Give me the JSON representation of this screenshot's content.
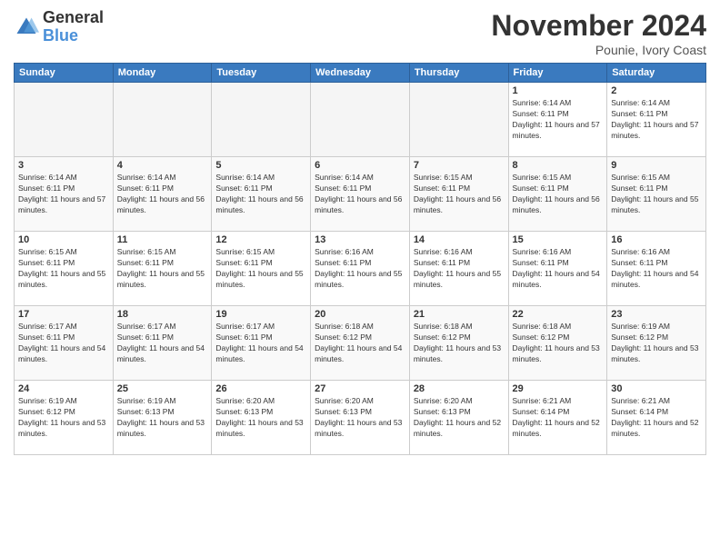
{
  "logo": {
    "general": "General",
    "blue": "Blue"
  },
  "title": "November 2024",
  "location": "Pounie, Ivory Coast",
  "days_of_week": [
    "Sunday",
    "Monday",
    "Tuesday",
    "Wednesday",
    "Thursday",
    "Friday",
    "Saturday"
  ],
  "weeks": [
    [
      {
        "day": "",
        "empty": true
      },
      {
        "day": "",
        "empty": true
      },
      {
        "day": "",
        "empty": true
      },
      {
        "day": "",
        "empty": true
      },
      {
        "day": "",
        "empty": true
      },
      {
        "day": "1",
        "sunrise": "Sunrise: 6:14 AM",
        "sunset": "Sunset: 6:11 PM",
        "daylight": "Daylight: 11 hours and 57 minutes."
      },
      {
        "day": "2",
        "sunrise": "Sunrise: 6:14 AM",
        "sunset": "Sunset: 6:11 PM",
        "daylight": "Daylight: 11 hours and 57 minutes."
      }
    ],
    [
      {
        "day": "3",
        "sunrise": "Sunrise: 6:14 AM",
        "sunset": "Sunset: 6:11 PM",
        "daylight": "Daylight: 11 hours and 57 minutes."
      },
      {
        "day": "4",
        "sunrise": "Sunrise: 6:14 AM",
        "sunset": "Sunset: 6:11 PM",
        "daylight": "Daylight: 11 hours and 56 minutes."
      },
      {
        "day": "5",
        "sunrise": "Sunrise: 6:14 AM",
        "sunset": "Sunset: 6:11 PM",
        "daylight": "Daylight: 11 hours and 56 minutes."
      },
      {
        "day": "6",
        "sunrise": "Sunrise: 6:14 AM",
        "sunset": "Sunset: 6:11 PM",
        "daylight": "Daylight: 11 hours and 56 minutes."
      },
      {
        "day": "7",
        "sunrise": "Sunrise: 6:15 AM",
        "sunset": "Sunset: 6:11 PM",
        "daylight": "Daylight: 11 hours and 56 minutes."
      },
      {
        "day": "8",
        "sunrise": "Sunrise: 6:15 AM",
        "sunset": "Sunset: 6:11 PM",
        "daylight": "Daylight: 11 hours and 56 minutes."
      },
      {
        "day": "9",
        "sunrise": "Sunrise: 6:15 AM",
        "sunset": "Sunset: 6:11 PM",
        "daylight": "Daylight: 11 hours and 55 minutes."
      }
    ],
    [
      {
        "day": "10",
        "sunrise": "Sunrise: 6:15 AM",
        "sunset": "Sunset: 6:11 PM",
        "daylight": "Daylight: 11 hours and 55 minutes."
      },
      {
        "day": "11",
        "sunrise": "Sunrise: 6:15 AM",
        "sunset": "Sunset: 6:11 PM",
        "daylight": "Daylight: 11 hours and 55 minutes."
      },
      {
        "day": "12",
        "sunrise": "Sunrise: 6:15 AM",
        "sunset": "Sunset: 6:11 PM",
        "daylight": "Daylight: 11 hours and 55 minutes."
      },
      {
        "day": "13",
        "sunrise": "Sunrise: 6:16 AM",
        "sunset": "Sunset: 6:11 PM",
        "daylight": "Daylight: 11 hours and 55 minutes."
      },
      {
        "day": "14",
        "sunrise": "Sunrise: 6:16 AM",
        "sunset": "Sunset: 6:11 PM",
        "daylight": "Daylight: 11 hours and 55 minutes."
      },
      {
        "day": "15",
        "sunrise": "Sunrise: 6:16 AM",
        "sunset": "Sunset: 6:11 PM",
        "daylight": "Daylight: 11 hours and 54 minutes."
      },
      {
        "day": "16",
        "sunrise": "Sunrise: 6:16 AM",
        "sunset": "Sunset: 6:11 PM",
        "daylight": "Daylight: 11 hours and 54 minutes."
      }
    ],
    [
      {
        "day": "17",
        "sunrise": "Sunrise: 6:17 AM",
        "sunset": "Sunset: 6:11 PM",
        "daylight": "Daylight: 11 hours and 54 minutes."
      },
      {
        "day": "18",
        "sunrise": "Sunrise: 6:17 AM",
        "sunset": "Sunset: 6:11 PM",
        "daylight": "Daylight: 11 hours and 54 minutes."
      },
      {
        "day": "19",
        "sunrise": "Sunrise: 6:17 AM",
        "sunset": "Sunset: 6:11 PM",
        "daylight": "Daylight: 11 hours and 54 minutes."
      },
      {
        "day": "20",
        "sunrise": "Sunrise: 6:18 AM",
        "sunset": "Sunset: 6:12 PM",
        "daylight": "Daylight: 11 hours and 54 minutes."
      },
      {
        "day": "21",
        "sunrise": "Sunrise: 6:18 AM",
        "sunset": "Sunset: 6:12 PM",
        "daylight": "Daylight: 11 hours and 53 minutes."
      },
      {
        "day": "22",
        "sunrise": "Sunrise: 6:18 AM",
        "sunset": "Sunset: 6:12 PM",
        "daylight": "Daylight: 11 hours and 53 minutes."
      },
      {
        "day": "23",
        "sunrise": "Sunrise: 6:19 AM",
        "sunset": "Sunset: 6:12 PM",
        "daylight": "Daylight: 11 hours and 53 minutes."
      }
    ],
    [
      {
        "day": "24",
        "sunrise": "Sunrise: 6:19 AM",
        "sunset": "Sunset: 6:12 PM",
        "daylight": "Daylight: 11 hours and 53 minutes."
      },
      {
        "day": "25",
        "sunrise": "Sunrise: 6:19 AM",
        "sunset": "Sunset: 6:13 PM",
        "daylight": "Daylight: 11 hours and 53 minutes."
      },
      {
        "day": "26",
        "sunrise": "Sunrise: 6:20 AM",
        "sunset": "Sunset: 6:13 PM",
        "daylight": "Daylight: 11 hours and 53 minutes."
      },
      {
        "day": "27",
        "sunrise": "Sunrise: 6:20 AM",
        "sunset": "Sunset: 6:13 PM",
        "daylight": "Daylight: 11 hours and 53 minutes."
      },
      {
        "day": "28",
        "sunrise": "Sunrise: 6:20 AM",
        "sunset": "Sunset: 6:13 PM",
        "daylight": "Daylight: 11 hours and 52 minutes."
      },
      {
        "day": "29",
        "sunrise": "Sunrise: 6:21 AM",
        "sunset": "Sunset: 6:14 PM",
        "daylight": "Daylight: 11 hours and 52 minutes."
      },
      {
        "day": "30",
        "sunrise": "Sunrise: 6:21 AM",
        "sunset": "Sunset: 6:14 PM",
        "daylight": "Daylight: 11 hours and 52 minutes."
      }
    ]
  ]
}
